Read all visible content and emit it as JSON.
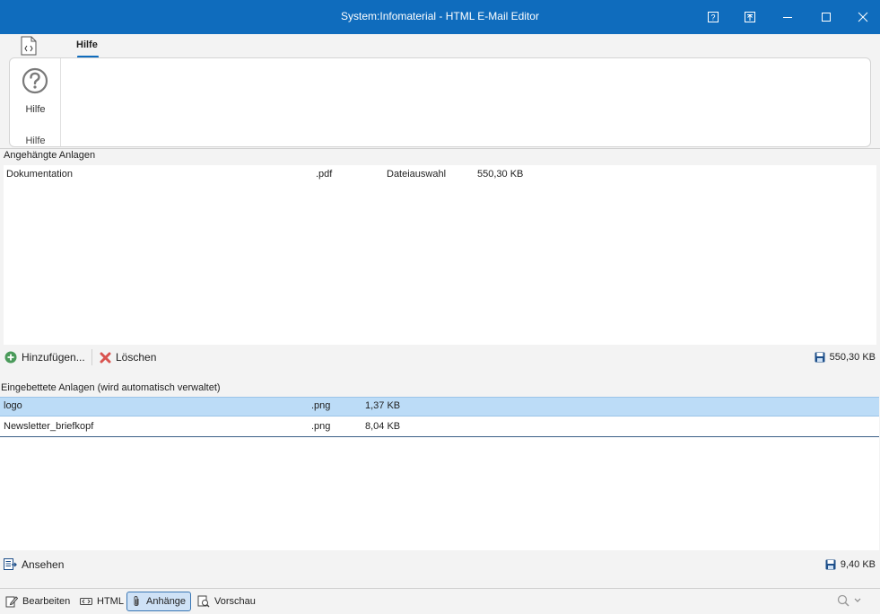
{
  "window": {
    "title": "System:Infomaterial - HTML E-Mail Editor"
  },
  "ribbon": {
    "tabs": [
      {
        "label": "Hilfe",
        "active": true
      }
    ],
    "groups": [
      {
        "label": "Hilfe",
        "buttons": [
          {
            "label": "Hilfe",
            "icon": "help-circle-icon"
          }
        ]
      }
    ]
  },
  "attached": {
    "title": "Angehängte Anlagen",
    "rows": [
      {
        "name": "Dokumentation",
        "ext": ".pdf",
        "source": "Dateiauswahl",
        "size": "550,30 KB"
      }
    ],
    "toolbar": {
      "add_label": "Hinzufügen...",
      "delete_label": "Löschen",
      "total_size": "550,30 KB"
    }
  },
  "embedded": {
    "title": "Eingebettete Anlagen (wird automatisch verwaltet)",
    "rows": [
      {
        "name": "logo",
        "ext": ".png",
        "size": "1,37 KB",
        "selected": true
      },
      {
        "name": "Newsletter_briefkopf",
        "ext": ".png",
        "size": "8,04 KB",
        "selected": false
      }
    ],
    "toolbar": {
      "view_label": "Ansehen",
      "total_size": "9,40 KB"
    }
  },
  "bottom_tabs": [
    {
      "label": "Bearbeiten",
      "icon": "edit-icon",
      "active": false
    },
    {
      "label": "HTML",
      "icon": "code-icon",
      "active": false
    },
    {
      "label": "Anhänge",
      "icon": "paperclip-icon",
      "active": true
    },
    {
      "label": "Vorschau",
      "icon": "preview-icon",
      "active": false
    }
  ],
  "colors": {
    "titlebar": "#0f6cbd",
    "selected_row": "#bcdcf7",
    "add_icon": "#4a9a5a",
    "delete_icon": "#d9534f"
  }
}
